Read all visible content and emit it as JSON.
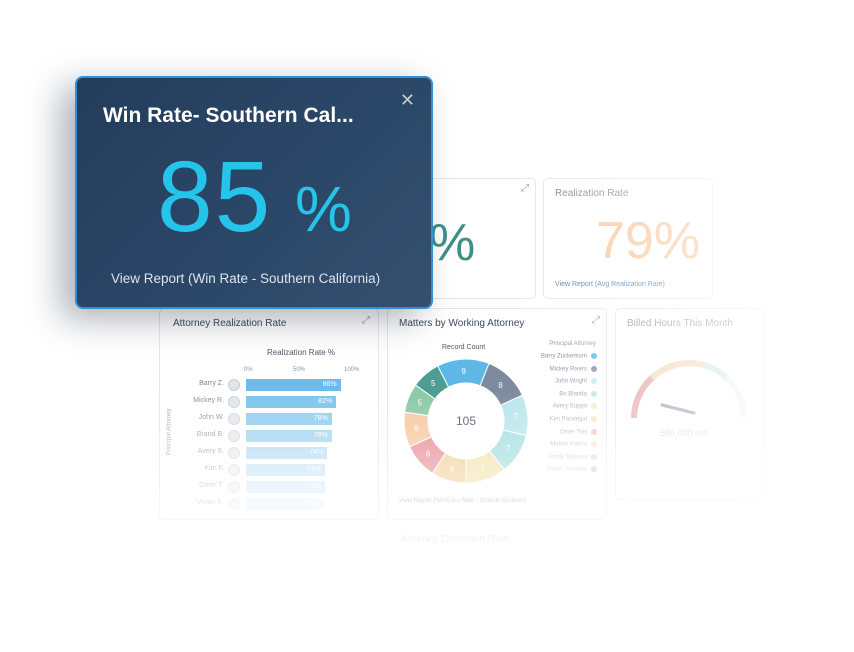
{
  "popup": {
    "title": "Win Rate- Southern Cal...",
    "value": "85",
    "unit": "%",
    "link": "View Report (Win Rate - Southern California)",
    "close": "✕"
  },
  "cards": {
    "hidden_pct": {
      "value": "%"
    },
    "realization": {
      "title": "Realization Rate",
      "value": "79%",
      "link": "View Report (Avg Realization Rate)"
    },
    "attorney_realization": {
      "title": "Attorney Realization Rate"
    },
    "matters": {
      "title": "Matters by Working Attorney",
      "footer_link": "View Report (Win/Loss Rate - Outside Counsel)"
    },
    "billed": {
      "title": "Billed Hours This Month",
      "gauge_value": "586,000 hrs"
    },
    "collections": {
      "title": "Attorney Collection Rate"
    }
  },
  "chart_data": [
    {
      "type": "bar",
      "title": "Realization Rate %",
      "ylabel": "Principal Attorney",
      "ticks": [
        "0%",
        "50%",
        "100%"
      ],
      "categories": [
        "Barry Z.",
        "Mickey R.",
        "John W.",
        "Brand B.",
        "Avery S.",
        "Kim F.",
        "Omer T.",
        "Vivian K."
      ],
      "values": [
        86,
        82,
        78,
        78,
        74,
        72,
        72,
        71
      ],
      "value_labels": [
        "86%",
        "82%",
        "78%",
        "78%",
        "74%",
        "72%",
        "72%",
        "71%"
      ],
      "colors": [
        "#6cbbea",
        "#75c0eb",
        "#80c6ed",
        "#8bcbee",
        "#98d1f0",
        "#a8d8f2",
        "#b9e0f5",
        "#cae8f8"
      ]
    },
    {
      "type": "pie",
      "title": "Record Count",
      "center_label": "105",
      "legend_title": "Principal Attorney",
      "slices": [
        {
          "name": "Barry Zuckerkorn",
          "value": 9,
          "color": "#5db8e8"
        },
        {
          "name": "Mickey Rivers",
          "value": 8,
          "color": "#7d8aa0"
        },
        {
          "name": "John Wright",
          "value": 7,
          "color": "#b9e6ea"
        },
        {
          "name": "Bo Blanda",
          "value": 7,
          "color": "#a6dfe0"
        },
        {
          "name": "Avery Suppo",
          "value": 7,
          "color": "#f3e3b0"
        },
        {
          "name": "Kim Paralegal",
          "value": 6,
          "color": "#f2d29e"
        },
        {
          "name": "Omer Tsei",
          "value": 6,
          "color": "#e9909a"
        },
        {
          "name": "Miriam Kaimo",
          "value": 6,
          "color": "#f6c9a2"
        },
        {
          "name": "Emily Stevens",
          "value": 5,
          "color": "#8cc9a8"
        },
        {
          "name": "Adam Stackley",
          "value": 5,
          "color": "#4e9d94"
        }
      ]
    }
  ]
}
